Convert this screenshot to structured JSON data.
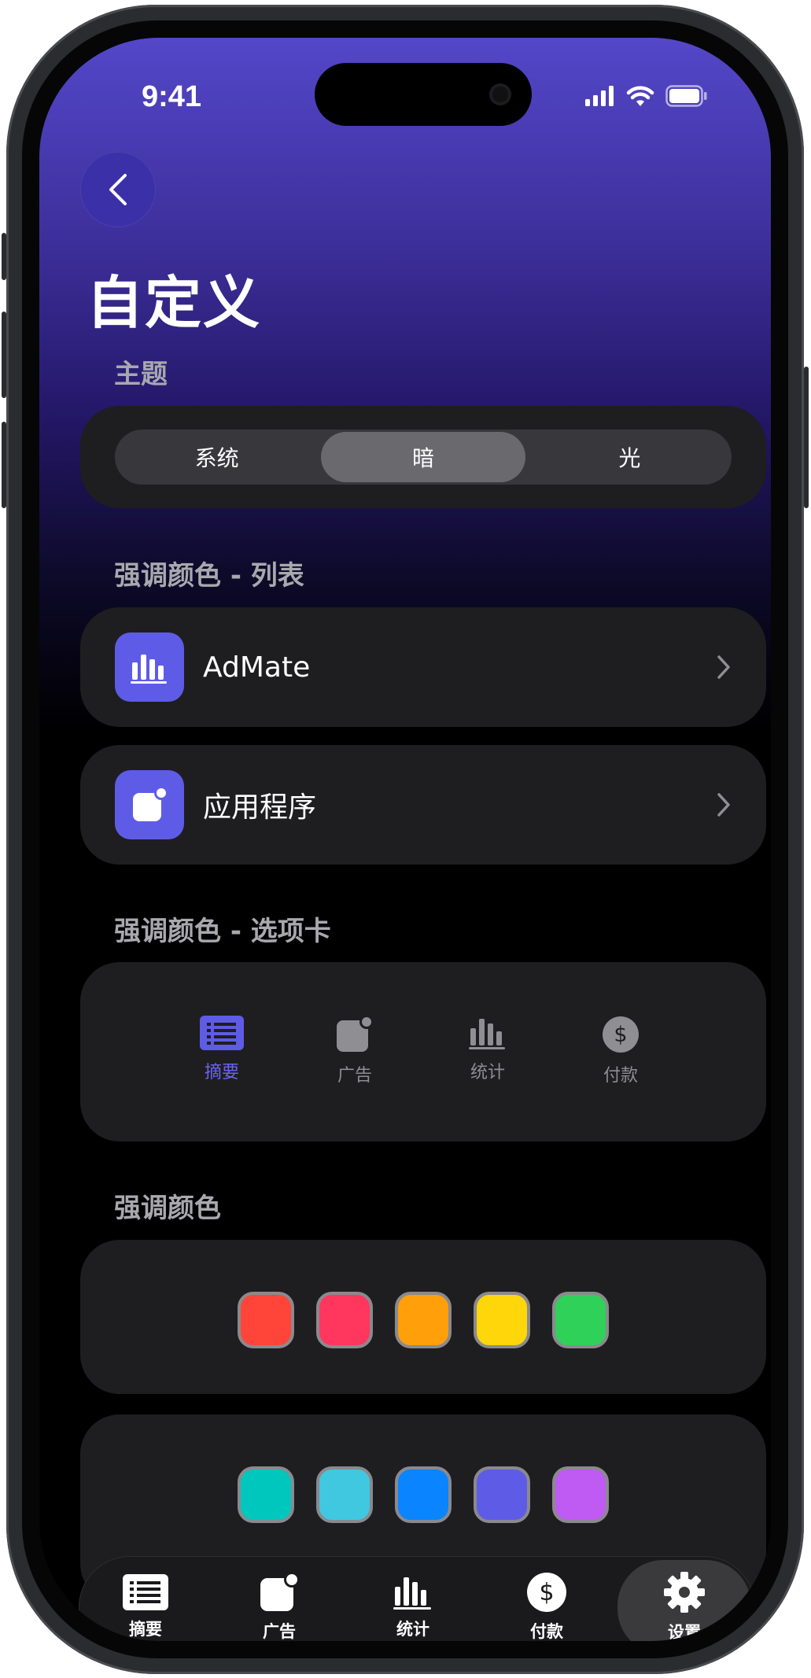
{
  "status_bar": {
    "time": "9:41"
  },
  "header": {
    "back_icon": "chevron-left-icon",
    "title": "自定义"
  },
  "theme": {
    "label": "主题",
    "options": [
      "系统",
      "暗",
      "光"
    ],
    "selected": "暗"
  },
  "accent_list": {
    "label": "强调颜色 - 列表",
    "items": [
      {
        "icon": "bar-chart-icon",
        "label": "AdMate"
      },
      {
        "icon": "app-badge-icon",
        "label": "应用程序"
      }
    ]
  },
  "accent_tabs": {
    "label": "强调颜色 - 选项卡",
    "tabs": [
      {
        "icon": "list-icon",
        "label": "摘要",
        "active": true
      },
      {
        "icon": "app-badge-icon",
        "label": "广告"
      },
      {
        "icon": "bar-chart-icon",
        "label": "统计"
      },
      {
        "icon": "dollar-circle-icon",
        "label": "付款"
      }
    ],
    "active_color": "#5E5CE6",
    "inactive_color": "#8E8E93"
  },
  "accent_colors": {
    "label": "强调颜色",
    "row1": [
      "#FF453A",
      "#FF375F",
      "#FF9F0A",
      "#FFD60A",
      "#30D158"
    ],
    "row2": [
      "#00C7BE",
      "#40C8E0",
      "#0A84FF",
      "#5E5CE6",
      "#BF5AF2"
    ]
  },
  "tab_bar": {
    "items": [
      {
        "icon": "list-icon",
        "label": "摘要"
      },
      {
        "icon": "app-badge-icon",
        "label": "广告"
      },
      {
        "icon": "bar-chart-icon",
        "label": "统计"
      },
      {
        "icon": "dollar-circle-icon",
        "label": "付款"
      },
      {
        "icon": "gear-icon",
        "label": "设置",
        "selected": true
      }
    ]
  }
}
